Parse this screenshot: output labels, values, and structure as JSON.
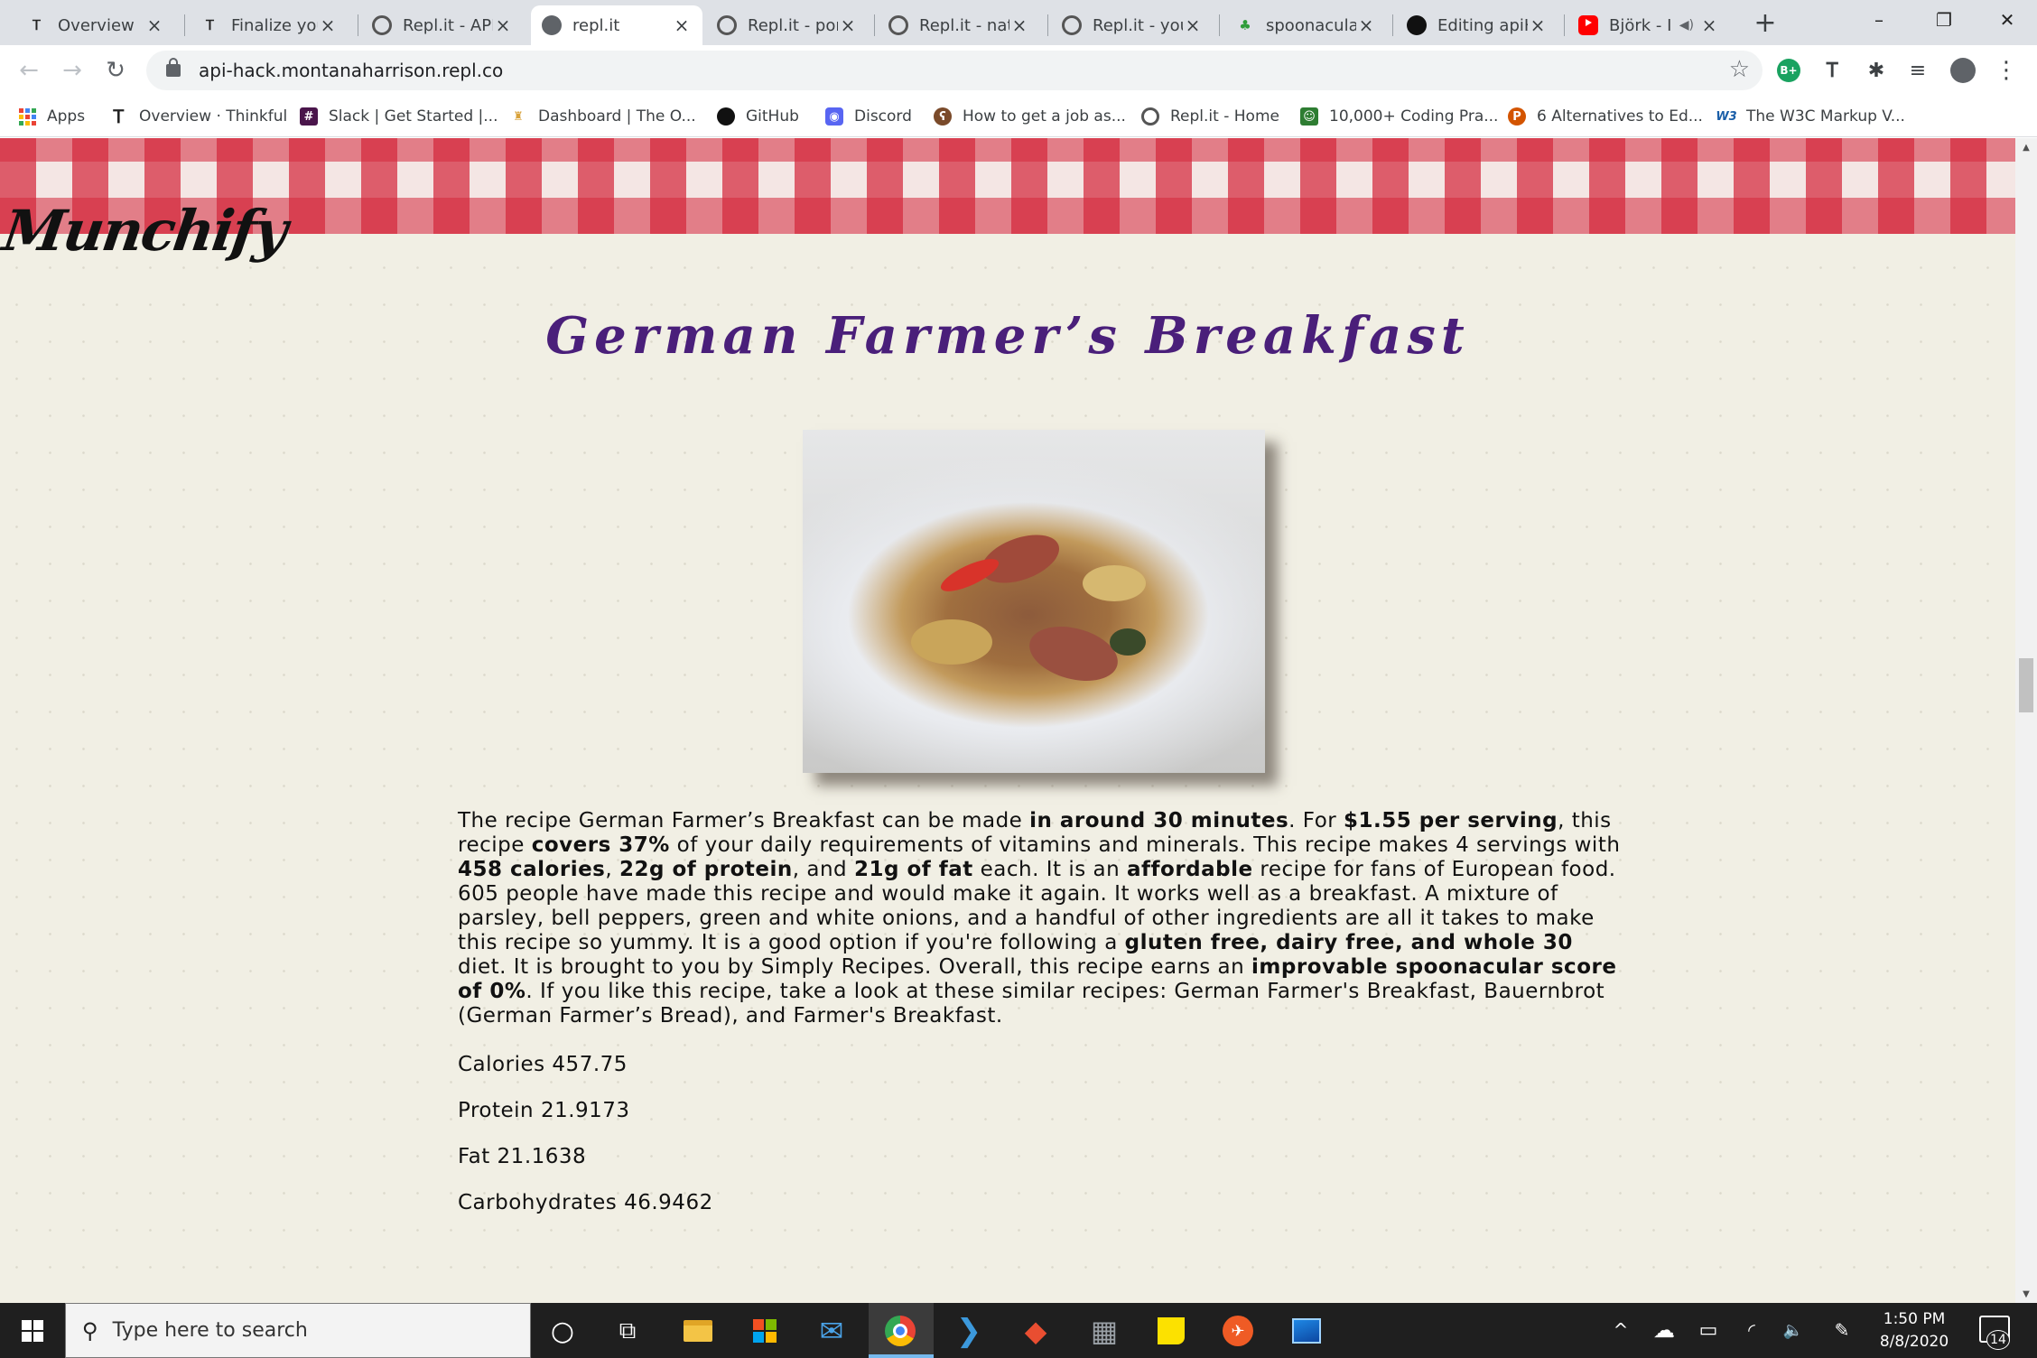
{
  "browser": {
    "tabs": [
      {
        "title": "Overview",
        "icon": "thinkful-icon",
        "active": false,
        "muted": false
      },
      {
        "title": "Finalize you",
        "icon": "thinkful-icon",
        "active": false,
        "muted": false
      },
      {
        "title": "Repl.it - API",
        "icon": "replit-icon",
        "active": false,
        "muted": false
      },
      {
        "title": "repl.it",
        "icon": "globe-icon",
        "active": true,
        "muted": false
      },
      {
        "title": "Repl.it - por",
        "icon": "replit-icon",
        "active": false,
        "muted": false
      },
      {
        "title": "Repl.it - nat",
        "icon": "replit-icon",
        "active": false,
        "muted": false
      },
      {
        "title": "Repl.it - you",
        "icon": "replit-icon",
        "active": false,
        "muted": false
      },
      {
        "title": "spoonacular",
        "icon": "spoonacular-icon",
        "active": false,
        "muted": false
      },
      {
        "title": "Editing apiH",
        "icon": "github-icon",
        "active": false,
        "muted": false
      },
      {
        "title": "Björk - I",
        "icon": "youtube-icon",
        "active": false,
        "muted": true
      }
    ],
    "new_tab_symbol": "+",
    "window_controls": {
      "minimize": "–",
      "maximize": "❐",
      "close": "✕"
    },
    "nav": {
      "back": "←",
      "forward": "→",
      "reload": "↻"
    },
    "url": "api-hack.montanaharrison.repl.co",
    "bookmark_star": "☆",
    "extensions": [
      {
        "name": "bplus-extension-icon",
        "label": "B+"
      },
      {
        "name": "thinkful-extension-icon",
        "label": "Ꭲ"
      },
      {
        "name": "puzzle-extensions-icon",
        "label": "✱"
      },
      {
        "name": "reading-list-icon",
        "label": "≡"
      },
      {
        "name": "profile-avatar-icon",
        "label": ""
      },
      {
        "name": "menu-kebab-icon",
        "label": "⋮"
      }
    ],
    "bookmarks": [
      {
        "label": "Apps",
        "icon": "apps-grid-icon"
      },
      {
        "label": "Overview · Thinkful",
        "icon": "thinkful-icon"
      },
      {
        "label": "Slack | Get Started |...",
        "icon": "slack-icon"
      },
      {
        "label": "Dashboard | The O...",
        "icon": "odin-icon"
      },
      {
        "label": "GitHub",
        "icon": "github-icon"
      },
      {
        "label": "Discord",
        "icon": "discord-icon"
      },
      {
        "label": "How to get a job as...",
        "icon": "bear-icon"
      },
      {
        "label": "Repl.it - Home",
        "icon": "replit-icon"
      },
      {
        "label": "10,000+ Coding Pra...",
        "icon": "codewars-icon"
      },
      {
        "label": "6 Alternatives to Ed...",
        "icon": "p-circle-icon"
      },
      {
        "label": "The W3C Markup V...",
        "icon": "w3c-icon"
      }
    ]
  },
  "page": {
    "logo": "Munchify",
    "recipe_title": "German Farmer’s Breakfast",
    "image_alt": "German Farmer's Breakfast photo",
    "summary": [
      {
        "text": "The recipe German Farmer’s Breakfast can be made ",
        "bold": false
      },
      {
        "text": "in around 30 minutes",
        "bold": true
      },
      {
        "text": ". For ",
        "bold": false
      },
      {
        "text": "$1.55 per serving",
        "bold": true
      },
      {
        "text": ", this recipe ",
        "bold": false
      },
      {
        "text": "covers 37%",
        "bold": true
      },
      {
        "text": " of your daily requirements of vitamins and minerals. This recipe makes 4 servings with ",
        "bold": false
      },
      {
        "text": "458 calories",
        "bold": true
      },
      {
        "text": ", ",
        "bold": false
      },
      {
        "text": "22g of protein",
        "bold": true
      },
      {
        "text": ", and ",
        "bold": false
      },
      {
        "text": "21g of fat",
        "bold": true
      },
      {
        "text": " each. It is an ",
        "bold": false
      },
      {
        "text": "affordable",
        "bold": true
      },
      {
        "text": " recipe for fans of European food. 605 people have made this recipe and would make it again. It works well as a breakfast. A mixture of parsley, bell peppers, green and white onions, and a handful of other ingredients are all it takes to make this recipe so yummy. It is a good option if you're following a ",
        "bold": false
      },
      {
        "text": "gluten free, dairy free, and whole 30",
        "bold": true
      },
      {
        "text": " diet. It is brought to you by Simply Recipes. Overall, this recipe earns an ",
        "bold": false
      },
      {
        "text": "improvable spoonacular score of 0%",
        "bold": true
      },
      {
        "text": ". If you like this recipe, take a look at these similar recipes: German Farmer's Breakfast, Bauernbrot (German Farmer’s Bread), and Farmer's Breakfast.",
        "bold": false
      }
    ],
    "nutrition": [
      {
        "label": "Calories",
        "value": "457.75"
      },
      {
        "label": "Protein",
        "value": "21.9173"
      },
      {
        "label": "Fat",
        "value": "21.1638"
      },
      {
        "label": "Carbohydrates",
        "value": "46.9462"
      }
    ],
    "colors": {
      "title": "#4a1f7a",
      "banner_red": "#d4283c",
      "background": "#f1efe4"
    }
  },
  "scrollbar": {
    "up": "▲",
    "down": "▼"
  },
  "taskbar": {
    "search_placeholder": "Type here to search",
    "apps": [
      {
        "name": "cortana-icon",
        "glyph": "○"
      },
      {
        "name": "task-view-icon",
        "glyph": "⧉"
      },
      {
        "name": "file-explorer-icon",
        "glyph": ""
      },
      {
        "name": "microsoft-store-icon",
        "glyph": ""
      },
      {
        "name": "mail-icon",
        "glyph": "✉"
      },
      {
        "name": "chrome-icon",
        "glyph": ""
      },
      {
        "name": "vscode-icon",
        "glyph": "❯"
      },
      {
        "name": "git-icon",
        "glyph": "◆"
      },
      {
        "name": "calculator-icon",
        "glyph": "▦"
      },
      {
        "name": "sticky-notes-icon",
        "glyph": ""
      },
      {
        "name": "postman-icon",
        "glyph": "✈"
      },
      {
        "name": "photos-icon",
        "glyph": ""
      }
    ],
    "tray": [
      {
        "name": "show-hidden-icons-icon",
        "glyph": "^"
      },
      {
        "name": "onedrive-icon",
        "glyph": "☁"
      },
      {
        "name": "battery-icon",
        "glyph": "▭"
      },
      {
        "name": "wifi-icon",
        "glyph": "◜"
      },
      {
        "name": "volume-icon",
        "glyph": "🔈"
      },
      {
        "name": "pen-icon",
        "glyph": "✎"
      }
    ],
    "time": "1:50 PM",
    "date": "8/8/2020",
    "notification_count": "14"
  }
}
